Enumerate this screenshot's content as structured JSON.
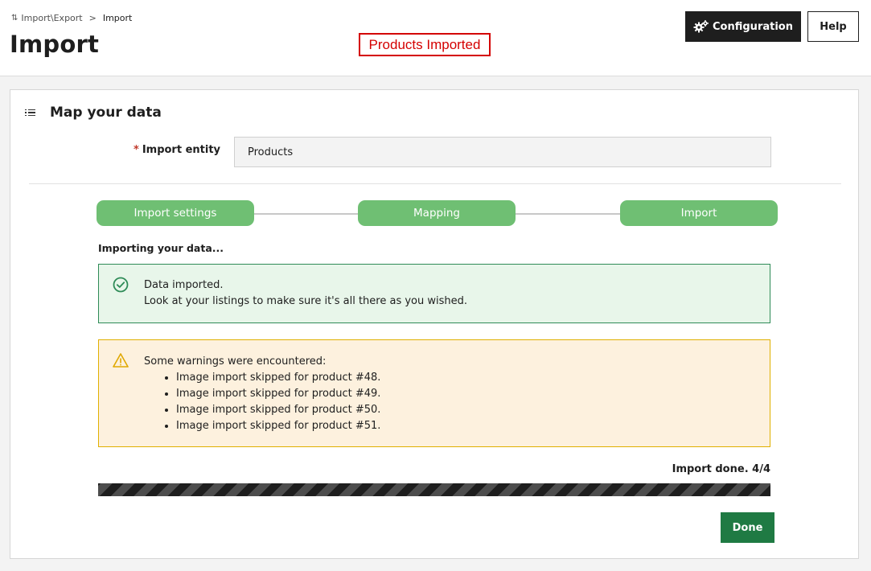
{
  "header": {
    "breadcrumb": {
      "parent": "Import\\Export",
      "separator": ">",
      "current": "Import"
    },
    "title": "Import",
    "annotation": "Products Imported",
    "buttons": {
      "configuration": "Configuration",
      "help": "Help"
    }
  },
  "card": {
    "title": "Map your data",
    "entity": {
      "required_marker": "*",
      "label": "Import entity",
      "value": "Products"
    },
    "steps": [
      "Import settings",
      "Mapping",
      "Import"
    ],
    "status_heading": "Importing your data...",
    "success": {
      "line1": "Data imported.",
      "line2": "Look at your listings to make sure it's all there as you wished."
    },
    "warning": {
      "heading": "Some warnings were encountered:",
      "items": [
        "Image import skipped for product #48.",
        "Image import skipped for product #49.",
        "Image import skipped for product #50.",
        "Image import skipped for product #51."
      ]
    },
    "progress": {
      "label": "Import done. 4/4",
      "fraction": 1.0
    },
    "done_button": "Done"
  },
  "colors": {
    "step_green": "#6fbf73",
    "success_border": "#2e8b57",
    "success_bg": "#e8f6ea",
    "warning_border": "#e0b000",
    "warning_bg": "#fdf1de",
    "done_button": "#1f7a43",
    "annotation_red": "#d40000",
    "dark": "#1e1e1e"
  },
  "icons": {
    "breadcrumb": "import-export-arrows-icon",
    "configuration": "gears-icon",
    "card": "list-icon",
    "success": "check-circle-icon",
    "warning": "warning-triangle-icon"
  }
}
